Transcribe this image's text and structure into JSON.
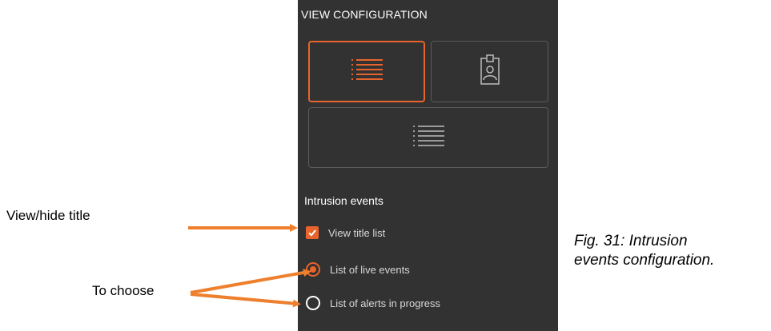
{
  "panel": {
    "title": "VIEW CONFIGURATION",
    "view_buttons": [
      {
        "icon": "list-icon",
        "selected": true
      },
      {
        "icon": "badge-icon",
        "selected": false
      },
      {
        "icon": "list-icon",
        "selected": false
      }
    ],
    "section_title": "Intrusion events",
    "checkbox_option": {
      "label": "View title list",
      "checked": true
    },
    "radio_options": [
      {
        "label": "List of live events",
        "selected": true
      },
      {
        "label": "List of alerts in progress",
        "selected": false
      }
    ]
  },
  "annotations": {
    "view_hide": "View/hide title",
    "choose": "To choose"
  },
  "caption": {
    "line1": "Fig. 31: Intrusion",
    "line2": "events configuration."
  },
  "colors": {
    "panel_bg": "#323232",
    "accent": "#e8642c",
    "arrow": "#ee7f2d"
  }
}
